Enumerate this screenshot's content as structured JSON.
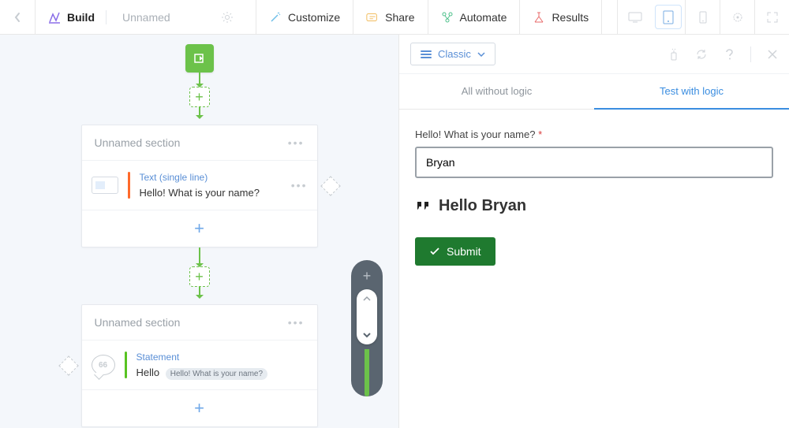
{
  "toolbar": {
    "build": "Build",
    "name": "Unnamed",
    "customize": "Customize",
    "share": "Share",
    "automate": "Automate",
    "results": "Results"
  },
  "canvas": {
    "section1": {
      "title": "Unnamed section",
      "question_type": "Text (single line)",
      "question_text": "Hello! What is your name?"
    },
    "section2": {
      "title": "Unnamed section",
      "question_type": "Statement",
      "question_text": "Hello",
      "pill": "Hello! What is your name?"
    }
  },
  "preview": {
    "theme": "Classic",
    "tab_all": "All without logic",
    "tab_test": "Test with logic",
    "question": "Hello! What is your name?",
    "required_mark": "*",
    "input_value": "Bryan",
    "statement": "Hello Bryan",
    "submit": "Submit"
  }
}
